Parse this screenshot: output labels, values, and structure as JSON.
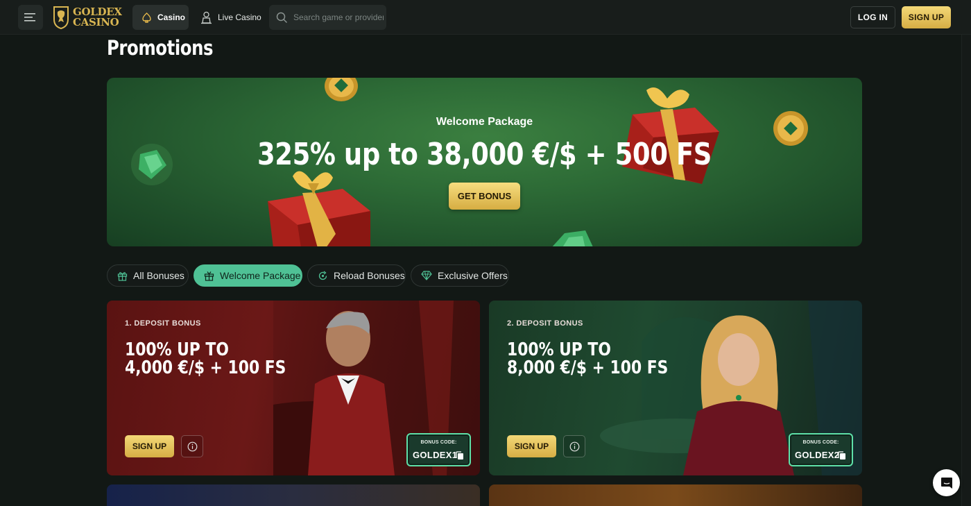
{
  "header": {
    "logo_line1": "GOLDEX",
    "logo_line2": "CASINO",
    "nav_casino": "Casino",
    "nav_live": "Live Casino",
    "search_placeholder": "Search game or provider",
    "login": "LOG IN",
    "signup": "SIGN UP"
  },
  "page_title": "Promotions",
  "hero": {
    "subtitle": "Welcome Package",
    "title": "325% up to 38,000 €/$ + 500 FS",
    "button": "GET BONUS"
  },
  "tabs": [
    {
      "label": "All Bonuses",
      "icon": "gift-icon",
      "active": false
    },
    {
      "label": "Welcome Package",
      "icon": "gift-box-icon",
      "active": true
    },
    {
      "label": "Reload Bonuses",
      "icon": "reload-icon",
      "active": false
    },
    {
      "label": "Exclusive Offers",
      "icon": "diamond-icon",
      "active": false
    }
  ],
  "cards": [
    {
      "label": "1. DEPOSIT BONUS",
      "title_line1": "100% UP TO",
      "title_line2": "4,000 €/$ + 100 FS",
      "signup": "SIGN UP",
      "code_label": "BONUS CODE:",
      "code": "GOLDEX1"
    },
    {
      "label": "2. DEPOSIT BONUS",
      "title_line1": "100% UP TO",
      "title_line2": "8,000 €/$ + 100 FS",
      "signup": "SIGN UP",
      "code_label": "BONUS CODE:",
      "code": "GOLDEX2"
    }
  ],
  "colors": {
    "background": "#121815",
    "gold": "#d6ae45",
    "accent_green": "#4fc195",
    "hero_green": "#2d6b36"
  }
}
